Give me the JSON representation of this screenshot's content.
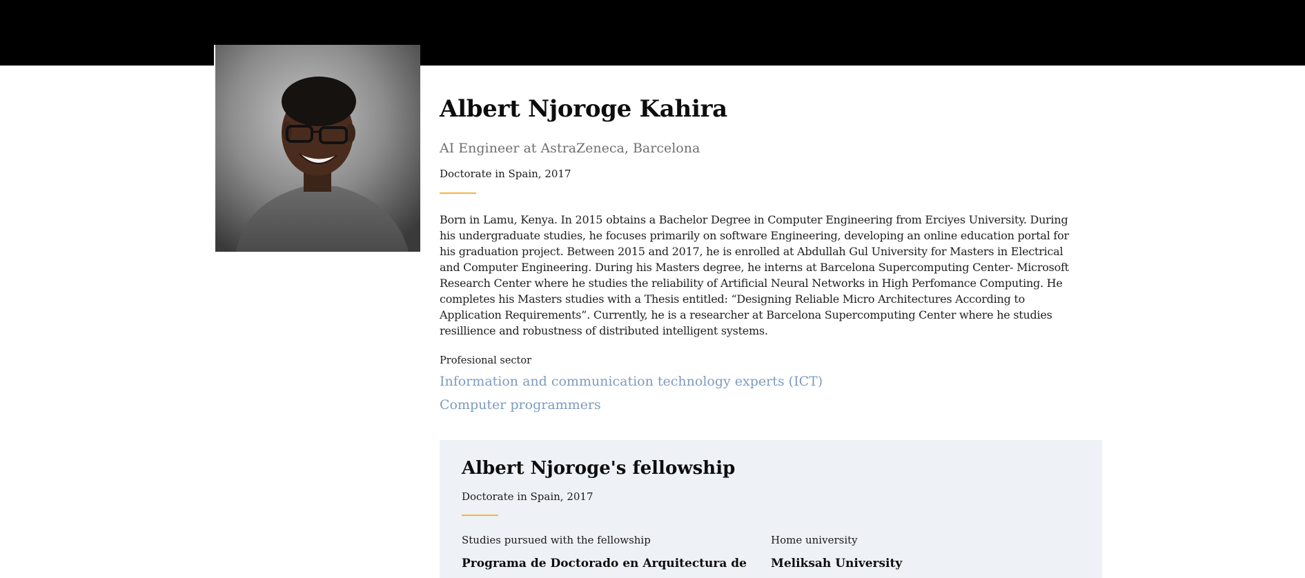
{
  "profile": {
    "name": "Albert Njoroge Kahira",
    "position": "AI Engineer at AstraZeneca, Barcelona",
    "degree": "Doctorate in Spain, 2017",
    "bio": "Born in Lamu, Kenya. In 2015 obtains a Bachelor Degree in Computer Engineering from Erciyes University. During his undergraduate studies, he focuses primarily on software Engineering, developing an online education portal for his graduation project. Between 2015 and 2017, he is enrolled at Abdullah Gul University for Masters in Electrical and Computer Engineering. During his Masters degree, he interns at Barcelona Supercomputing Center- Microsoft Research Center where he studies the reliability of Artificial Neural Networks in High Perfomance Computing. He completes his Masters studies with a Thesis entitled: “Designing Reliable Micro Architectures According to Application Requirements”. Currently, he is a researcher at Barcelona Supercomputing Center where he studies resillience and robustness of distributed intelligent systems.",
    "sector_label": "Profesional sector",
    "sectors": [
      "Information and communication technology experts (ICT)",
      "Computer programmers"
    ]
  },
  "fellowship": {
    "title": "Albert Njoroge's fellowship",
    "degree": "Doctorate in Spain, 2017",
    "studies_label": "Studies pursued with the fellowship",
    "studies_value": "Programa de Doctorado en Arquitectura de",
    "home_label": "Home university",
    "home_value": "Meliksah University"
  },
  "colors": {
    "header": "#000000",
    "accent": "#f2b53a",
    "link": "#7d9bbf",
    "panel": "#eef1f5"
  }
}
